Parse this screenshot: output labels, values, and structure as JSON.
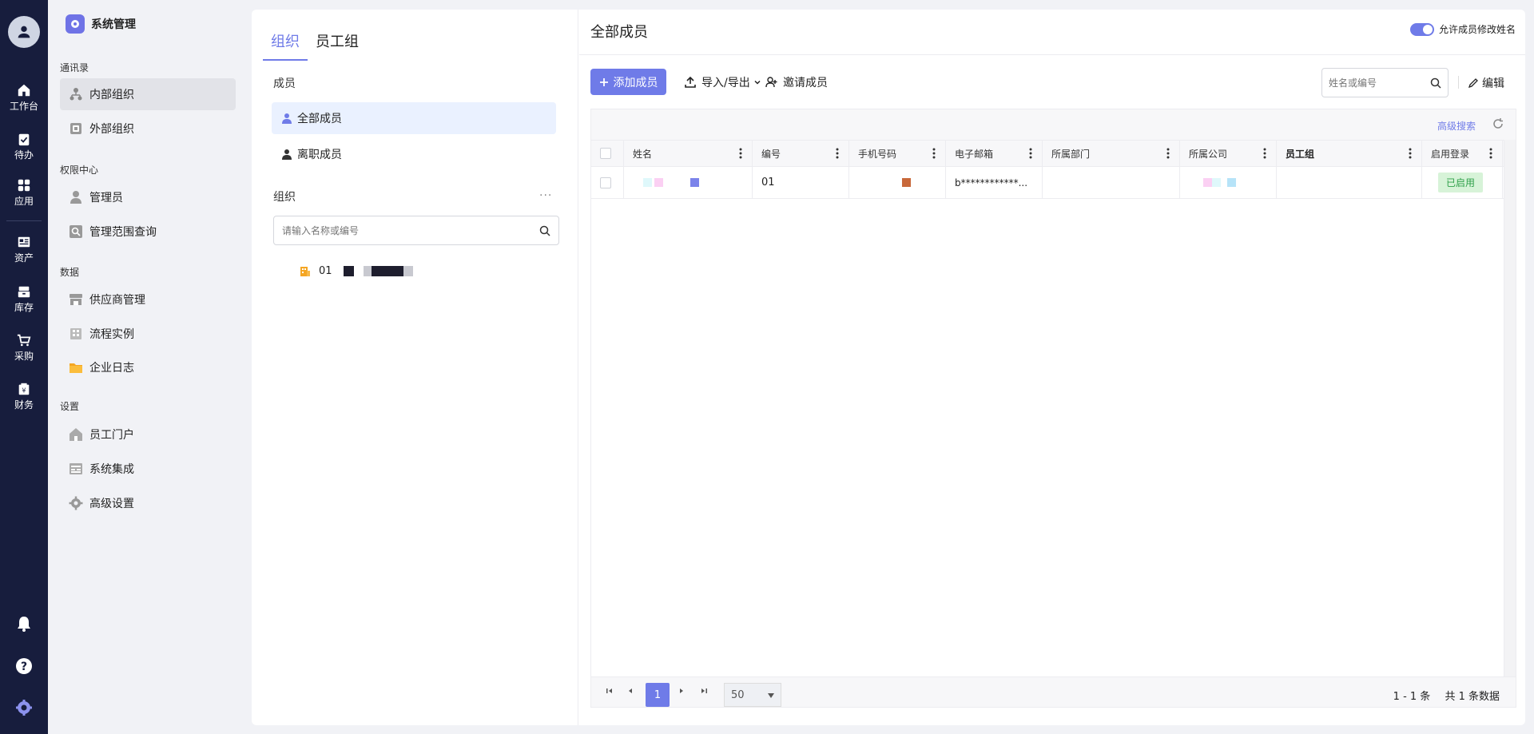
{
  "rail": {
    "items": [
      {
        "label": "工作台",
        "icon": "home-icon"
      },
      {
        "label": "待办",
        "icon": "clipboard-check-icon"
      },
      {
        "label": "应用",
        "icon": "apps-grid-icon"
      },
      {
        "label": "资产",
        "icon": "asset-card-icon"
      },
      {
        "label": "库存",
        "icon": "inventory-box-icon"
      },
      {
        "label": "采购",
        "icon": "cart-icon"
      },
      {
        "label": "财务",
        "icon": "wallet-icon"
      }
    ],
    "bottom_icons": [
      "bell-icon",
      "help-icon",
      "settings-gear-icon"
    ]
  },
  "sidebar": {
    "brand": "系统管理",
    "sections": [
      {
        "title": "通讯录",
        "items": [
          {
            "label": "内部组织",
            "icon": "org-tree-icon",
            "active": true
          },
          {
            "label": "外部组织",
            "icon": "external-org-icon"
          }
        ]
      },
      {
        "title": "权限中心",
        "items": [
          {
            "label": "管理员",
            "icon": "admin-user-icon"
          },
          {
            "label": "管理范围查询",
            "icon": "scope-search-icon"
          }
        ]
      },
      {
        "title": "数据",
        "items": [
          {
            "label": "供应商管理",
            "icon": "store-icon"
          },
          {
            "label": "流程实例",
            "icon": "flow-icon"
          },
          {
            "label": "企业日志",
            "icon": "folder-icon"
          }
        ]
      },
      {
        "title": "设置",
        "items": [
          {
            "label": "员工门户",
            "icon": "portal-house-icon"
          },
          {
            "label": "系统集成",
            "icon": "integration-icon"
          },
          {
            "label": "高级设置",
            "icon": "advanced-gear-icon"
          }
        ]
      }
    ]
  },
  "org_panel": {
    "tabs": [
      "组织",
      "员工组"
    ],
    "members_label": "成员",
    "member_items": [
      "全部成员",
      "离职成员"
    ],
    "org_label": "组织",
    "more": "···",
    "search_placeholder": "请输入名称或编号",
    "tree_root_code": "01"
  },
  "main": {
    "title": "全部成员",
    "toggle_label": "允许成员修改姓名",
    "toggle_on": true,
    "add_button": "添加成员",
    "import_export": "导入/导出",
    "invite": "邀请成员",
    "search_placeholder": "姓名或编号",
    "edit": "编辑",
    "advanced_search": "高级搜索",
    "columns": [
      "姓名",
      "编号",
      "手机号码",
      "电子邮箱",
      "所属部门",
      "所属公司",
      "员工组",
      "启用登录"
    ],
    "rows": [
      {
        "name": "",
        "code": "01",
        "phone": "",
        "email": "b************...",
        "department": "",
        "company": "",
        "group": "",
        "login_status": "已启用"
      }
    ],
    "pagination": {
      "current_page": "1",
      "page_size": "50",
      "range": "1 - 1 条",
      "total": "共 1 条数据"
    }
  },
  "colors": {
    "accent": "#6f7be8",
    "rail_bg": "#171d3d",
    "status_green": "#2fa04a"
  }
}
